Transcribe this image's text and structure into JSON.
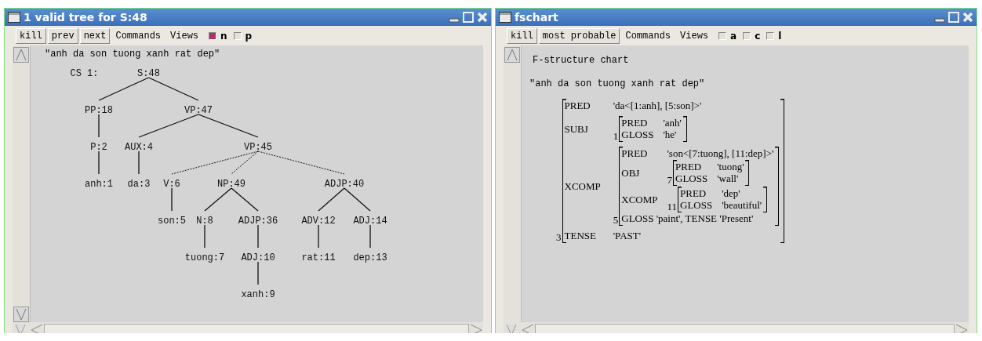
{
  "tree_window": {
    "title": "1 valid tree for S:48",
    "buttons": [
      "kill",
      "prev",
      "next"
    ],
    "menus": [
      "Commands",
      "Views"
    ],
    "toggles": [
      {
        "label": "n",
        "checked": true
      },
      {
        "label": "p",
        "checked": false
      }
    ],
    "sentence": "\"anh da son tuong xanh rat dep\"",
    "tree": {
      "prefix": "CS 1:",
      "root": {
        "label": "S:48",
        "children": [
          {
            "label": "PP:18",
            "children": [
              {
                "label": "P:2",
                "children": [
                  {
                    "label": "anh:1"
                  }
                ]
              }
            ]
          },
          {
            "label": "VP:47",
            "children": [
              {
                "label": "AUX:4",
                "children": [
                  {
                    "label": "da:3"
                  }
                ]
              },
              {
                "label": "VP:45",
                "dotted_edges": true,
                "children": [
                  {
                    "label": "V:6",
                    "children": [
                      {
                        "label": "son:5"
                      }
                    ]
                  },
                  {
                    "label": "NP:49",
                    "children": [
                      {
                        "label": "N:8",
                        "children": [
                          {
                            "label": "tuong:7"
                          }
                        ]
                      },
                      {
                        "label": "ADJP:36",
                        "children": [
                          {
                            "label": "ADJ:10",
                            "children": [
                              {
                                "label": "xanh:9"
                              }
                            ]
                          }
                        ]
                      }
                    ]
                  },
                  {
                    "label": "ADJP:40",
                    "children": [
                      {
                        "label": "ADV:12",
                        "children": [
                          {
                            "label": "rat:11"
                          }
                        ]
                      },
                      {
                        "label": "ADJ:14",
                        "children": [
                          {
                            "label": "dep:13"
                          }
                        ]
                      }
                    ]
                  }
                ]
              }
            ]
          }
        ]
      }
    }
  },
  "fs_window": {
    "title": "fschart",
    "buttons": [
      "kill",
      "most probable"
    ],
    "menus": [
      "Commands",
      "Views"
    ],
    "toggles": [
      {
        "label": "a",
        "checked": false
      },
      {
        "label": "c",
        "checked": false
      },
      {
        "label": "l",
        "checked": false
      }
    ],
    "heading": "F-structure chart",
    "sentence": "\"anh da son tuong xanh rat dep\"",
    "fstructure": {
      "index": "3",
      "attrs": [
        {
          "name": "PRED",
          "value": "'da<[1:anh], [5:son]>'"
        },
        {
          "name": "SUBJ",
          "fs": {
            "index": "1",
            "attrs": [
              {
                "name": "PRED",
                "value": "'anh'"
              },
              {
                "name": "GLOSS",
                "value": "'he'"
              }
            ]
          }
        },
        {
          "name": "XCOMP",
          "fs": {
            "index": "5",
            "attrs": [
              {
                "name": "PRED",
                "value": "'son<[7:tuong], [11:dep]>'"
              },
              {
                "name": "OBJ",
                "fs": {
                  "index": "7",
                  "attrs": [
                    {
                      "name": "PRED",
                      "value": "'tuong'"
                    },
                    {
                      "name": "GLOSS",
                      "value": "'wall'"
                    }
                  ]
                }
              },
              {
                "name": "XCOMP",
                "fs": {
                  "index": "11",
                  "attrs": [
                    {
                      "name": "PRED",
                      "value": "'dep'"
                    },
                    {
                      "name": "GLOSS",
                      "value": "'beautiful'"
                    }
                  ]
                }
              },
              {
                "kind": "line",
                "text": "GLOSS 'paint', TENSE 'Present'"
              }
            ]
          }
        },
        {
          "name": "TENSE",
          "value": "'PAST'"
        }
      ]
    }
  }
}
